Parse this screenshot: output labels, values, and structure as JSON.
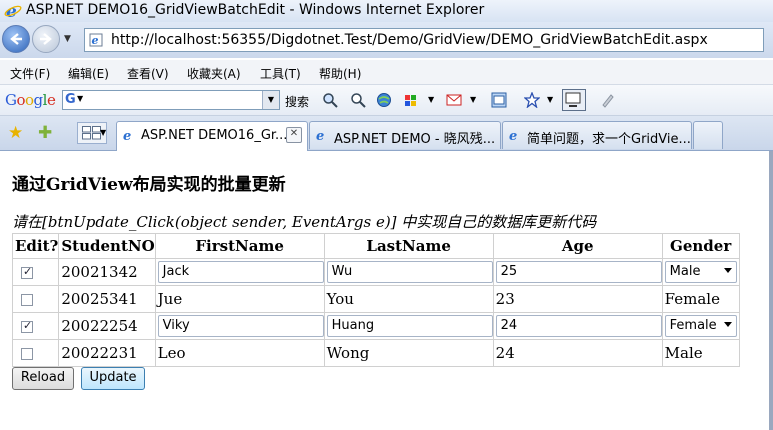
{
  "window": {
    "title": "ASP.NET DEMO16_GridViewBatchEdit - Windows Internet Explorer"
  },
  "address": {
    "url": "http://localhost:56355/Digdotnet.Test/Demo/GridView/DEMO_GridViewBatchEdit.aspx"
  },
  "menu": {
    "items": [
      "文件(F)",
      "编辑(E)",
      "查看(V)",
      "收藏夹(A)",
      "工具(T)",
      "帮助(H)"
    ]
  },
  "google_toolbar": {
    "logo": "Google",
    "search_value": "",
    "search_label": "搜索"
  },
  "tabs": [
    {
      "label": "ASP.NET DEMO16_Gr...",
      "active": true
    },
    {
      "label": "ASP.NET DEMO - 晓风残...",
      "active": false
    },
    {
      "label": "简单问题，求一个GridVie...",
      "active": false
    }
  ],
  "page": {
    "heading": "通过GridView布局实现的批量更新",
    "hint": "请在[btnUpdate_Click(object sender, EventArgs e)] 中实现自己的数据库更新代码",
    "columns": [
      "Edit?",
      "StudentNO",
      "FirstName",
      "LastName",
      "Age",
      "Gender"
    ],
    "rows": [
      {
        "checked": true,
        "student_no": "20021342",
        "first_name": "Jack",
        "last_name": "Wu",
        "age": "25",
        "gender": "Male",
        "editing": true
      },
      {
        "checked": false,
        "student_no": "20025341",
        "first_name": "Jue",
        "last_name": "You",
        "age": "23",
        "gender": "Female",
        "editing": false
      },
      {
        "checked": true,
        "student_no": "20022254",
        "first_name": "Viky",
        "last_name": "Huang",
        "age": "24",
        "gender": "Female",
        "editing": true
      },
      {
        "checked": false,
        "student_no": "20022231",
        "first_name": "Leo",
        "last_name": "Wong",
        "age": "24",
        "gender": "Male",
        "editing": false
      }
    ],
    "buttons": {
      "reload": "Reload",
      "update": "Update"
    }
  },
  "colors": {
    "accent": "#3c7fb1",
    "chrome": "#cbd8ec"
  }
}
